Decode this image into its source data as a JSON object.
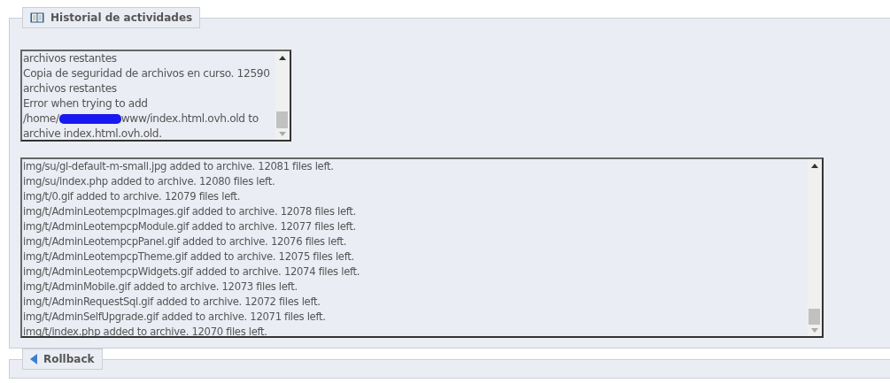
{
  "activity_history": {
    "title": "Historial de actividades",
    "status_log": [
      {
        "parts": [
          "archivos restantes"
        ]
      },
      {
        "parts": [
          "Copia de seguridad de archivos en curso. 12590"
        ]
      },
      {
        "parts": [
          "archivos restantes"
        ]
      },
      {
        "parts": [
          "Error when trying to add"
        ]
      },
      {
        "parts": [
          "/home/",
          "www/index.html.ovh.old to"
        ]
      },
      {
        "parts": [
          "archive index.html.ovh.old."
        ]
      }
    ],
    "file_log": [
      "img/su/gl-default-m-small.jpg added to archive. 12081 files left.",
      "img/su/index.php added to archive. 12080 files left.",
      "img/t/0.gif added to archive. 12079 files left.",
      "img/t/AdminLeotempcpImages.gif added to archive. 12078 files left.",
      "img/t/AdminLeotempcpModule.gif added to archive. 12077 files left.",
      "img/t/AdminLeotempcpPanel.gif added to archive. 12076 files left.",
      "img/t/AdminLeotempcpTheme.gif added to archive. 12075 files left.",
      "img/t/AdminLeotempcpWidgets.gif added to archive. 12074 files left.",
      "img/t/AdminMobile.gif added to archive. 12073 files left.",
      "img/t/AdminRequestSql.gif added to archive. 12072 files left.",
      "img/t/AdminSelfUpgrade.gif added to archive. 12071 files left.",
      "img/t/index.php added to archive. 12070 files left."
    ]
  },
  "rollback": {
    "title": "Rollback"
  }
}
